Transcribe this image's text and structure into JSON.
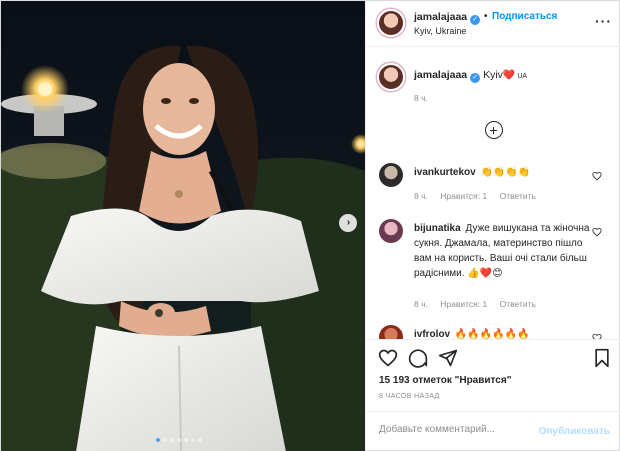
{
  "header": {
    "username": "jamalajaaa",
    "separator": "•",
    "follow_label": "Подписаться",
    "location": "Kyiv, Ukraine",
    "more_icon": "ellipsis-icon"
  },
  "caption": {
    "username": "jamalajaaa",
    "text": "Kyiv",
    "emoji": "❤️",
    "flag": "UA",
    "time": "8 ч."
  },
  "comments": [
    {
      "username": "ivankurtekov",
      "text": "👏👏👏👏",
      "time": "8 ч.",
      "likes": "Нравится: 1",
      "reply": "Ответить"
    },
    {
      "username": "bijunatika",
      "text": "Дуже вишукана та жіночна сукня. Джамала, материнство пішло вам на користь. Ваші очі стали більш радісними. 👍❤️😊",
      "time": "8 ч.",
      "likes": "Нравится: 1",
      "reply": "Ответить"
    },
    {
      "username": "ivfrolov",
      "text": "🔥🔥🔥🔥🔥🔥",
      "time": "",
      "likes": "",
      "reply": ""
    }
  ],
  "stats": {
    "likes_text": "15 193 отметок \"Нравится\"",
    "time_ago": "8 ЧАСОВ НАЗАД"
  },
  "add_comment": {
    "placeholder": "Добавьте комментарий...",
    "publish_label": "Опубликовать"
  },
  "media": {
    "carousel_total": 7,
    "carousel_active": 1
  },
  "colors": {
    "accent": "#0095f6",
    "publish_disabled": "#b2dffc",
    "verified": "#3897f0",
    "heart": "#e0245e"
  }
}
